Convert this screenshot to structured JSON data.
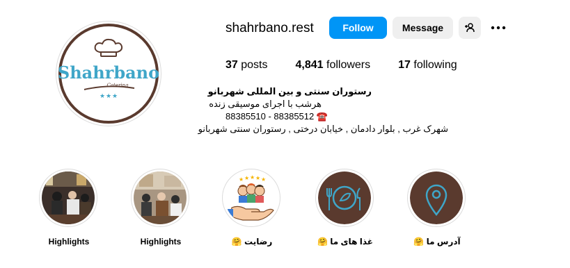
{
  "profile": {
    "avatar_logo_text": "Shahrbano",
    "avatar_logo_subtext": "Catering",
    "username": "shahrbano.rest",
    "follow_label": "Follow",
    "message_label": "Message"
  },
  "icons": {
    "add_user": "add-user-icon",
    "more": "more-options-icon"
  },
  "stats": {
    "posts_count": "37",
    "posts_label": "posts",
    "followers_count": "4,841",
    "followers_label": "followers",
    "following_count": "17",
    "following_label": "following"
  },
  "bio": {
    "name": "رستوران سنتی و بین المللی شهربانو",
    "line1": "هرشب با اجرای موسیقی زنده",
    "phone_emoji": "☎️",
    "phone": "88385510 - 88385512",
    "address": "شهرک غرب , بلوار دادمان , خیابان درختی , رستوران سنتی شهربانو"
  },
  "highlights": [
    {
      "label": "Highlights",
      "image": "restaurant-interior-photo"
    },
    {
      "label": "Highlights",
      "image": "dining-hall-photo"
    },
    {
      "label": "رضایت 🤗",
      "image": "customer-satisfaction-icon"
    },
    {
      "label": "غذا های ما 🤗",
      "image": "food-plate-icon"
    },
    {
      "label": "آدرس ما 🤗",
      "image": "location-pin-icon"
    }
  ],
  "colors": {
    "follow_blue": "#0095f6",
    "button_gray": "#efefef",
    "logo_brown": "#5a3a2e",
    "logo_teal": "#3fa6c8"
  }
}
